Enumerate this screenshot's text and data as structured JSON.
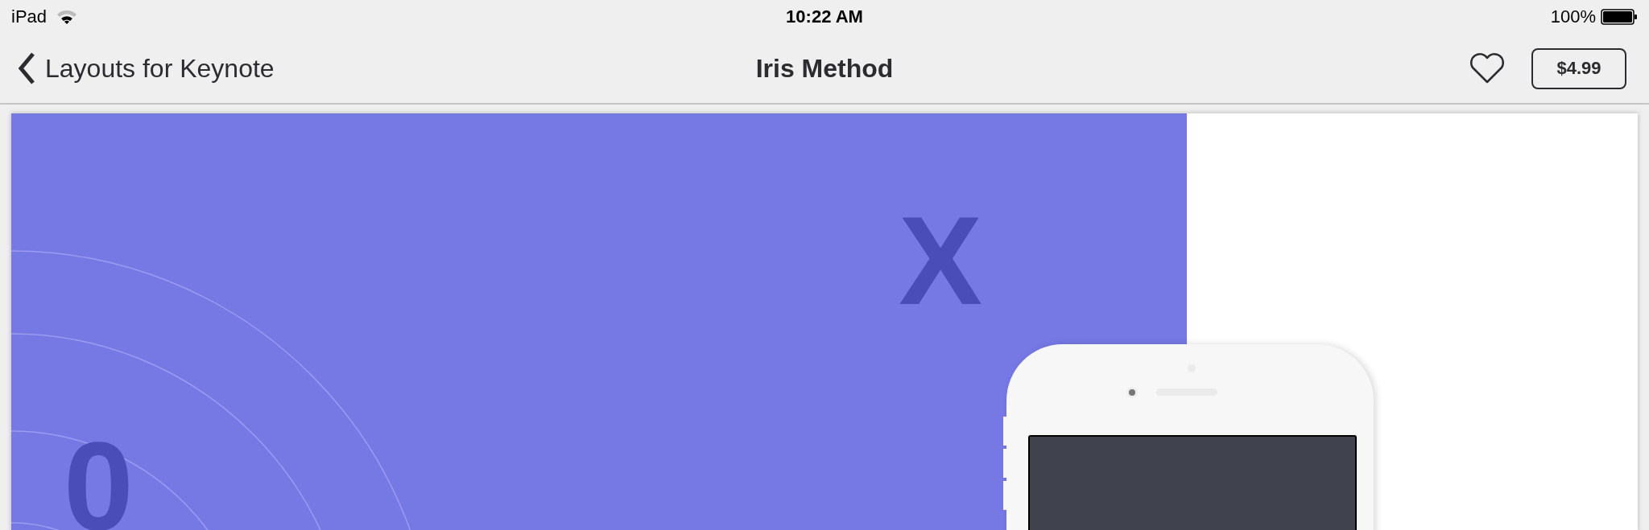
{
  "status_bar": {
    "device": "iPad",
    "time": "10:22 AM",
    "battery": "100%"
  },
  "nav_bar": {
    "back_label": "Layouts for Keynote",
    "title": "Iris Method",
    "favorited": false,
    "price": "$4.99"
  },
  "slide": {
    "texts": [
      {
        "text": "X"
      },
      {
        "text": "0"
      }
    ]
  }
}
